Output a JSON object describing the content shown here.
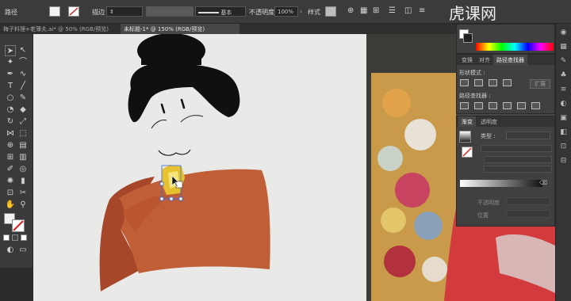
{
  "control_bar": {
    "path_label": "路径",
    "stroke_label": "描边",
    "basic_label": "基本",
    "opacity_label": "不透明度",
    "opacity_value": "100%",
    "style_label": "样式"
  },
  "doc_tabs": [
    {
      "label": "梅子料理+老薄夫.ai* @ 50% (RGB/预览)"
    },
    {
      "label": "未标题-1* @ 150% (RGB/预览)"
    }
  ],
  "watermark": "虎课网",
  "pathfinder_panel": {
    "tabs": [
      "变换",
      "对齐",
      "路径查找器"
    ],
    "shape_modes_label": "形状模式 :",
    "expand_label": "扩展",
    "pathfinders_label": "路径查找器 :"
  },
  "gradient_panel": {
    "tabs": [
      "渐变",
      "透明度"
    ],
    "type_label": "类型 :",
    "opacity_label": "不透明度",
    "position_label": "位置"
  },
  "colors": {
    "hair": "#101010",
    "robe": "#c05f37",
    "robe_shadow": "#a6472a",
    "canvas": "#e9eae7",
    "panel": "#404040"
  }
}
